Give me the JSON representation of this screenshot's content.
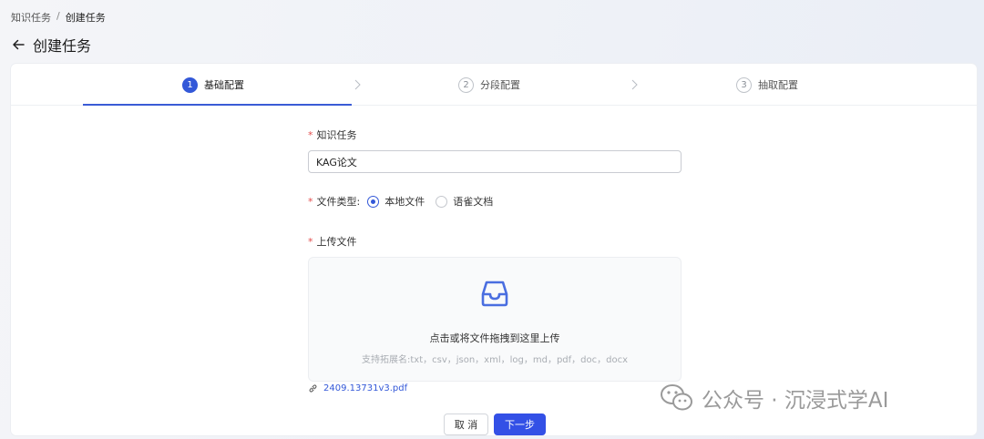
{
  "breadcrumb": {
    "parent": "知识任务",
    "separator": "/",
    "current": "创建任务"
  },
  "page": {
    "title": "创建任务"
  },
  "steps": [
    {
      "index": "1",
      "label": "基础配置",
      "active": true
    },
    {
      "index": "2",
      "label": "分段配置",
      "active": false
    },
    {
      "index": "3",
      "label": "抽取配置",
      "active": false
    }
  ],
  "form": {
    "task_label": "知识任务",
    "task_value": "KAG论文",
    "required_mark": "*",
    "file_type_label": "文件类型:",
    "file_type_options": [
      {
        "label": "本地文件",
        "selected": true
      },
      {
        "label": "语雀文档",
        "selected": false
      }
    ],
    "upload_label": "上传文件",
    "upload_hint": "点击或将文件拖拽到这里上传",
    "upload_formats": "支持拓展名:txt，csv，json，xml，log，md，pdf，doc，docx",
    "uploaded_file": "2409.13731v3.pdf"
  },
  "actions": {
    "cancel": "取 消",
    "next": "下一步"
  },
  "watermark": {
    "text": "公众号 · 沉浸式学AI"
  },
  "colors": {
    "primary": "#3358d8",
    "required": "#e34d4d"
  }
}
